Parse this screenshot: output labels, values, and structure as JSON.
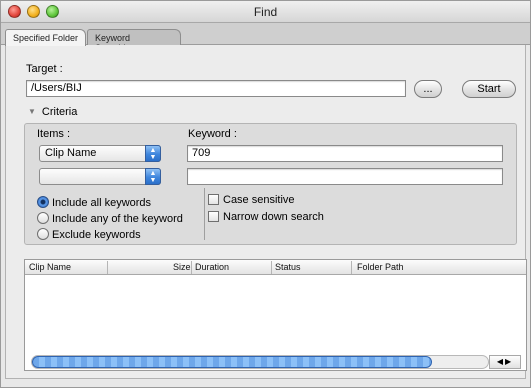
{
  "window": {
    "title": "Find"
  },
  "tabs": [
    {
      "label": "Specified Folder",
      "active": true
    },
    {
      "label": "Keyword Searching",
      "active": false
    }
  ],
  "target": {
    "label": "Target :",
    "value": "/Users/BIJ",
    "browse_label": "...",
    "start_label": "Start"
  },
  "criteria": {
    "toggle_label": "Criteria",
    "disclosure_icon": "triangle-down-icon",
    "items_label": "Items :",
    "keyword_label": "Keyword :",
    "rows": [
      {
        "item": "Clip Name",
        "keyword": "709"
      },
      {
        "item": "",
        "keyword": ""
      }
    ],
    "match_options": [
      {
        "label": "Include all keywords",
        "selected": true
      },
      {
        "label": "Include any of the keyword",
        "selected": false
      },
      {
        "label": "Exclude keywords",
        "selected": false
      }
    ],
    "checkboxes": [
      {
        "label": "Case sensitive",
        "checked": false
      },
      {
        "label": "Narrow down search",
        "checked": false
      }
    ]
  },
  "results": {
    "columns": [
      "Clip Name",
      "Size",
      "Duration",
      "Status",
      "Folder Path"
    ],
    "rows": []
  },
  "colors": {
    "accent": "#3f86dd",
    "window_bg": "#e8e8e8"
  }
}
